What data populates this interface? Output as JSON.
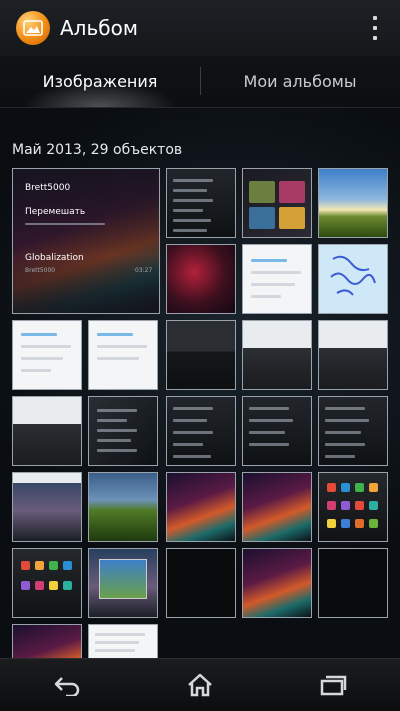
{
  "app": {
    "title": "Альбом",
    "icon": "album-icon"
  },
  "action_bar": {
    "overflow_icon": "overflow-menu-icon"
  },
  "tabs": [
    {
      "label": "Изображения",
      "active": true
    },
    {
      "label": "Мои альбомы",
      "active": false
    }
  ],
  "section": {
    "header": "Май 2013, 29 объектов"
  },
  "featured_thumb": {
    "line1": "Brett5000",
    "line2": "Перемешать",
    "line3": "Globalization",
    "line4": "Brett5000",
    "time": "03:27"
  },
  "navigation": {
    "back_icon": "back-icon",
    "home_icon": "home-icon",
    "recents_icon": "recent-apps-icon"
  },
  "colors": {
    "accent_orange": "#f08c12",
    "background": "#0b0f13",
    "thumb_border": "#9aa3ab"
  }
}
